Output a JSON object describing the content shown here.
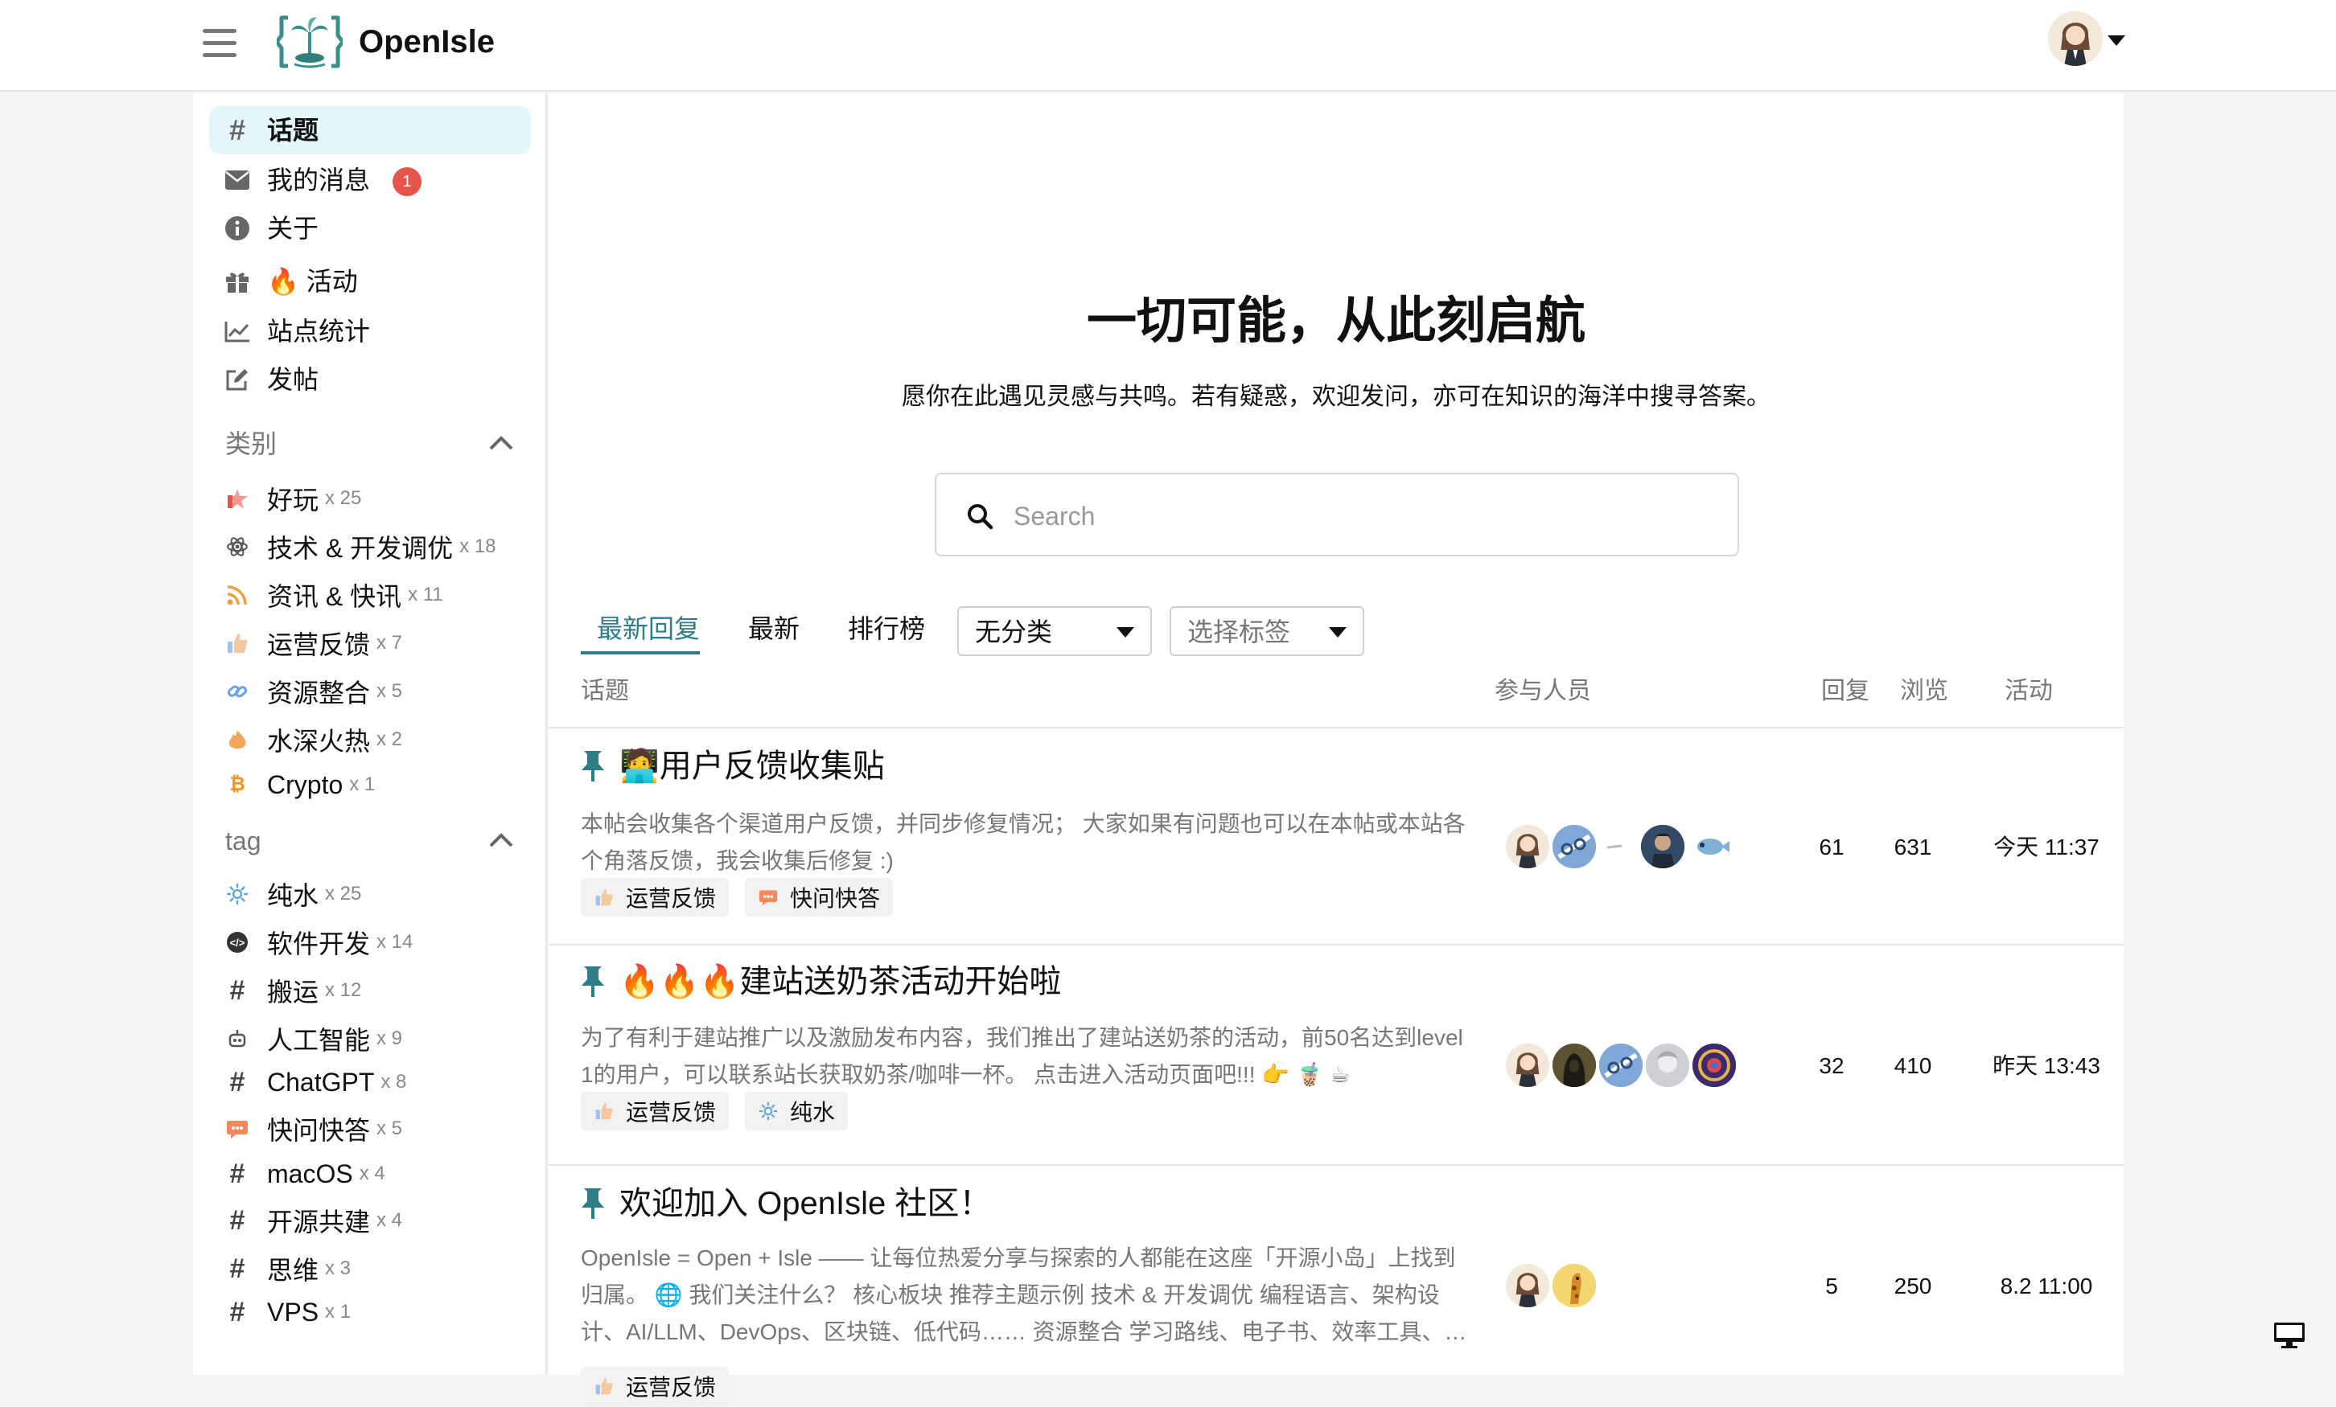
{
  "header": {
    "brand": "OpenIsle"
  },
  "sidebar": {
    "nav": [
      {
        "label": "话题",
        "icon": "hash-icon"
      },
      {
        "label": "我的消息",
        "icon": "envelope-icon",
        "badge": "1"
      },
      {
        "label": "关于",
        "icon": "info-icon"
      },
      {
        "label": "🔥 活动",
        "icon": "gift-icon"
      },
      {
        "label": "站点统计",
        "icon": "chart-line-icon"
      },
      {
        "label": "发帖",
        "icon": "edit-icon"
      }
    ],
    "categories_title": "类别",
    "categories": [
      {
        "label": "好玩",
        "count": "x 25",
        "icon": "fun-icon"
      },
      {
        "label": "技术 & 开发调优",
        "count": "x 18",
        "icon": "atom-icon"
      },
      {
        "label": "资讯 & 快讯",
        "count": "x 11",
        "icon": "rss-icon"
      },
      {
        "label": "运营反馈",
        "count": "x 7",
        "icon": "thumbs-up-icon"
      },
      {
        "label": "资源整合",
        "count": "x 5",
        "icon": "link-icon"
      },
      {
        "label": "水深火热",
        "count": "x 2",
        "icon": "fire-icon"
      },
      {
        "label": "Crypto",
        "count": "x 1",
        "icon": "bitcoin-icon"
      }
    ],
    "tags_title": "tag",
    "tags": [
      {
        "label": "纯水",
        "count": "x 25",
        "icon": "water-icon"
      },
      {
        "label": "软件开发",
        "count": "x 14",
        "icon": "dev-icon"
      },
      {
        "label": "搬运",
        "count": "x 12",
        "icon": "hash-icon"
      },
      {
        "label": "人工智能",
        "count": "x 9",
        "icon": "robot-icon"
      },
      {
        "label": "ChatGPT",
        "count": "x 8",
        "icon": "hash-icon"
      },
      {
        "label": "快问快答",
        "count": "x 5",
        "icon": "chat-icon"
      },
      {
        "label": "macOS",
        "count": "x 4",
        "icon": "hash-icon"
      },
      {
        "label": "开源共建",
        "count": "x 4",
        "icon": "hash-icon"
      },
      {
        "label": "思维",
        "count": "x 3",
        "icon": "hash-icon"
      },
      {
        "label": "VPS",
        "count": "x 1",
        "icon": "hash-icon"
      }
    ]
  },
  "hero": {
    "title": "一切可能，从此刻启航",
    "subtitle": "愿你在此遇见灵感与共鸣。若有疑惑，欢迎发问，亦可在知识的海洋中搜寻答案。"
  },
  "search": {
    "placeholder": "Search",
    "value": ""
  },
  "tabs": [
    "最新回复",
    "最新",
    "排行榜"
  ],
  "filters": {
    "category": "无分类",
    "tag": "选择标签"
  },
  "columns": {
    "topic": "话题",
    "participants": "参与人员",
    "replies": "回复",
    "views": "浏览",
    "activity": "活动"
  },
  "topics": [
    {
      "title": "🧑‍💻用户反馈收集贴",
      "excerpt": "本帖会收集各个渠道用户反馈，并同步修复情况； 大家如果有问题也可以在本帖或本站各个角落反馈，我会收集后修复 :)",
      "tags": [
        {
          "label": "运营反馈",
          "icon": "thumbs-up-icon"
        },
        {
          "label": "快问快答",
          "icon": "chat-icon"
        }
      ],
      "replies": "61",
      "views": "631",
      "activity": "今天 11:37"
    },
    {
      "title": "🔥🔥🔥建站送奶茶活动开始啦",
      "excerpt": "为了有利于建站推广以及激励发布内容，我们推出了建站送奶茶的活动，前50名达到level 1的用户，可以联系站长获取奶茶/咖啡一杯。 点击进入活动页面吧!!! 👉 🧋 ☕",
      "tags": [
        {
          "label": "运营反馈",
          "icon": "thumbs-up-icon"
        },
        {
          "label": "纯水",
          "icon": "water-icon"
        }
      ],
      "replies": "32",
      "views": "410",
      "activity": "昨天 13:43"
    },
    {
      "title": "欢迎加入 OpenIsle 社区！",
      "excerpt": "OpenIsle = Open + Isle —— 让每位热爱分享与探索的人都能在这座「开源小岛」上找到归属。 🌐 我们关注什么？ 核心板块 推荐主题示例 技术 & 开发调优 编程语言、架构设计、AI/LLM、DevOps、区块链、低代码…… 资源整合 学习路线、电子书、效率工具、…",
      "tags": [
        {
          "label": "运营反馈",
          "icon": "thumbs-up-icon"
        }
      ],
      "replies": "5",
      "views": "250",
      "activity": "8.2 11:00"
    }
  ],
  "colors": {
    "accent": "#2c7d86",
    "active_bg": "#e3f6f9",
    "badge": "#e5534b"
  }
}
